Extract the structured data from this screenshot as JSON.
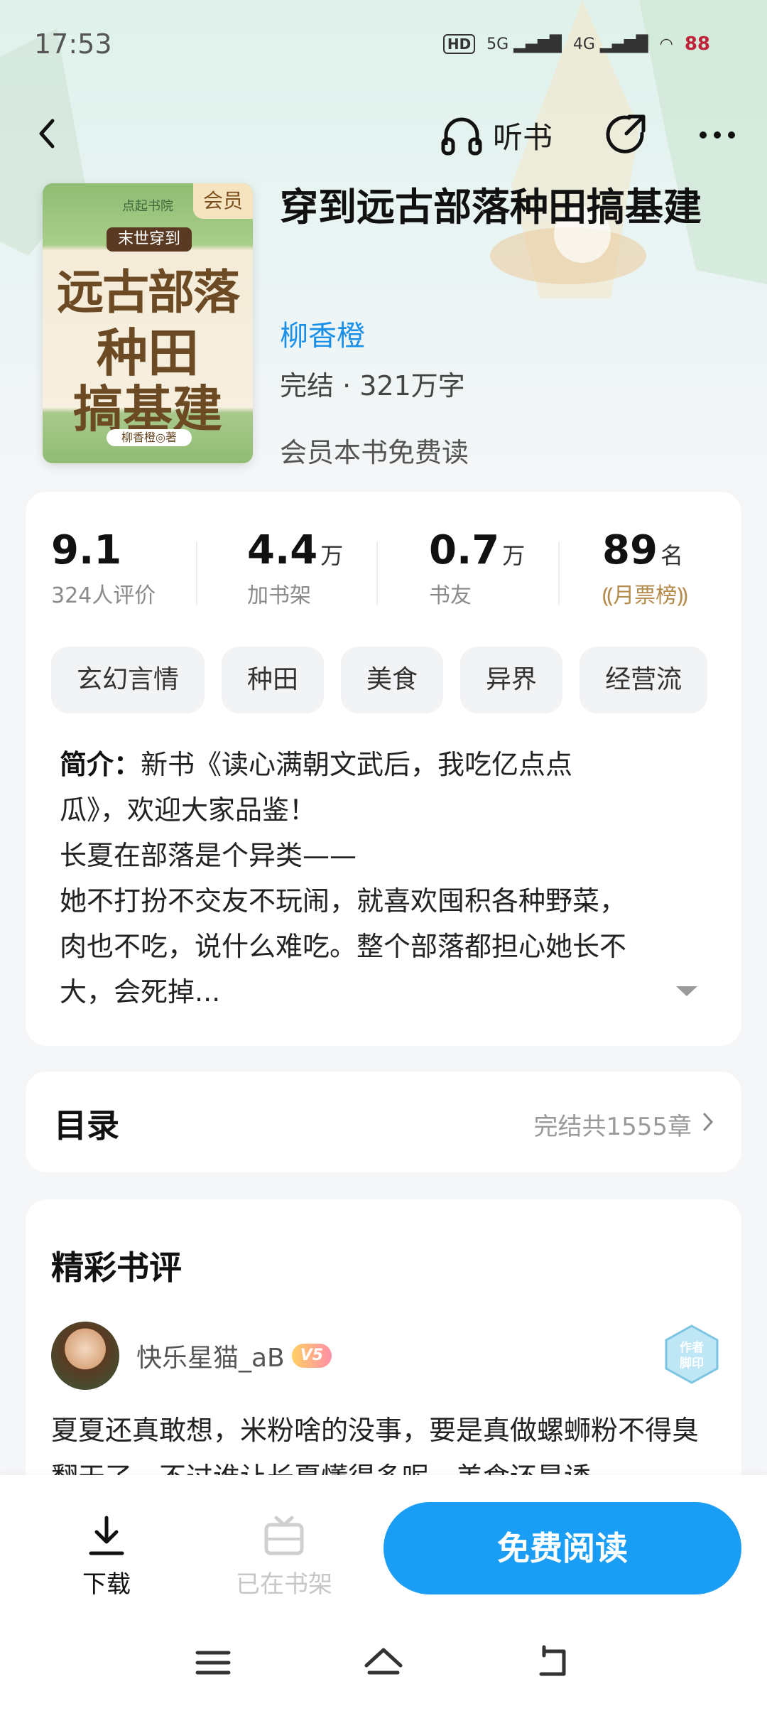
{
  "status_bar": {
    "time": "17:53",
    "network_hd": "HD",
    "network_5g": "5G",
    "network_4g": "4G",
    "battery": "88"
  },
  "header": {
    "listen_label": "听书"
  },
  "book": {
    "title": "穿到远古部落种田搞基建",
    "author": "柳香橙",
    "meta": "完结 · 321万字",
    "free_note": "会员本书免费读",
    "vip_badge": "会员",
    "cover": {
      "brand": "点起书院",
      "ribbon": "末世穿到",
      "line1": "远古部落",
      "line2": "种田",
      "line3": "搞基建",
      "author_tag": "柳香橙◎著"
    }
  },
  "stats": [
    {
      "value": "9.1",
      "unit": "",
      "label": "324人评价"
    },
    {
      "value": "4.4",
      "unit": "万",
      "label": "加书架"
    },
    {
      "value": "0.7",
      "unit": "万",
      "label": "书友"
    },
    {
      "value": "89",
      "unit": "名",
      "label": "月票榜"
    }
  ],
  "tags": [
    "玄幻言情",
    "种田",
    "美食",
    "异界",
    "经营流"
  ],
  "intro": {
    "label": "简介：",
    "line1": "新书《读心满朝文武后，我吃亿点点",
    "line2": "瓜》，欢迎大家品鉴！",
    "line3": "长夏在部落是个异类——",
    "line4": "她不打扮不交友不玩闹，就喜欢囤积各种野菜，",
    "line5": "肉也不吃，说什么难吃。整个部落都担心她长不",
    "line6": "大，会死掉..."
  },
  "toc": {
    "title": "目录",
    "count": "完结共1555章"
  },
  "reviews": {
    "title": "精彩书评",
    "items": [
      {
        "user": "快乐星猫_aB",
        "level": "V5",
        "badge_text": "作者脚印",
        "text": "夏夏还真敢想，米粉啥的没事，要是真做螺蛳粉不得臭翻天了。不过谁让长夏懂得多呢，美食还是诱"
      }
    ]
  },
  "bottom_bar": {
    "download_label": "下载",
    "shelf_label": "已在书架",
    "read_button": "免费阅读"
  },
  "colors": {
    "accent": "#1a9ef5",
    "author": "#1a8fe8",
    "rank": "#b48a4a"
  }
}
